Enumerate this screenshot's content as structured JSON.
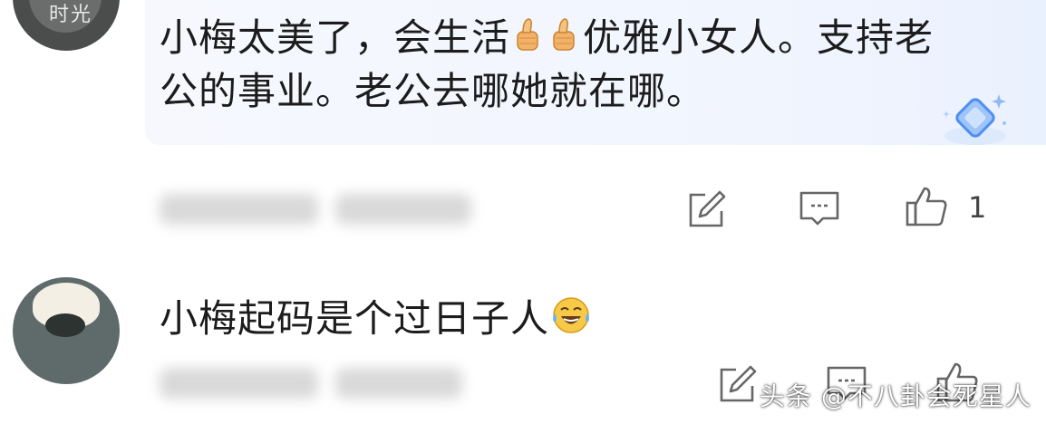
{
  "comments": [
    {
      "avatar_text": "时光",
      "text_before": "小梅太美了，会生活",
      "emoji_middle": [
        "thumbs-up",
        "thumbs-up"
      ],
      "text_after": "优雅小女人。支持老公的事业。老公去哪她就在哪。",
      "like_count": "1"
    },
    {
      "text": "小梅起码是个过日子人",
      "emoji_end": "laughing-crying-face"
    }
  ],
  "watermark": "头条 @不八卦会死星人",
  "colors": {
    "bubble_bg": "#f2f6fe",
    "icon_stroke": "#666666",
    "text": "#1c1c1c"
  },
  "icons": [
    "edit-icon",
    "reply-icon",
    "like-icon",
    "sparkle-diamond-icon"
  ]
}
